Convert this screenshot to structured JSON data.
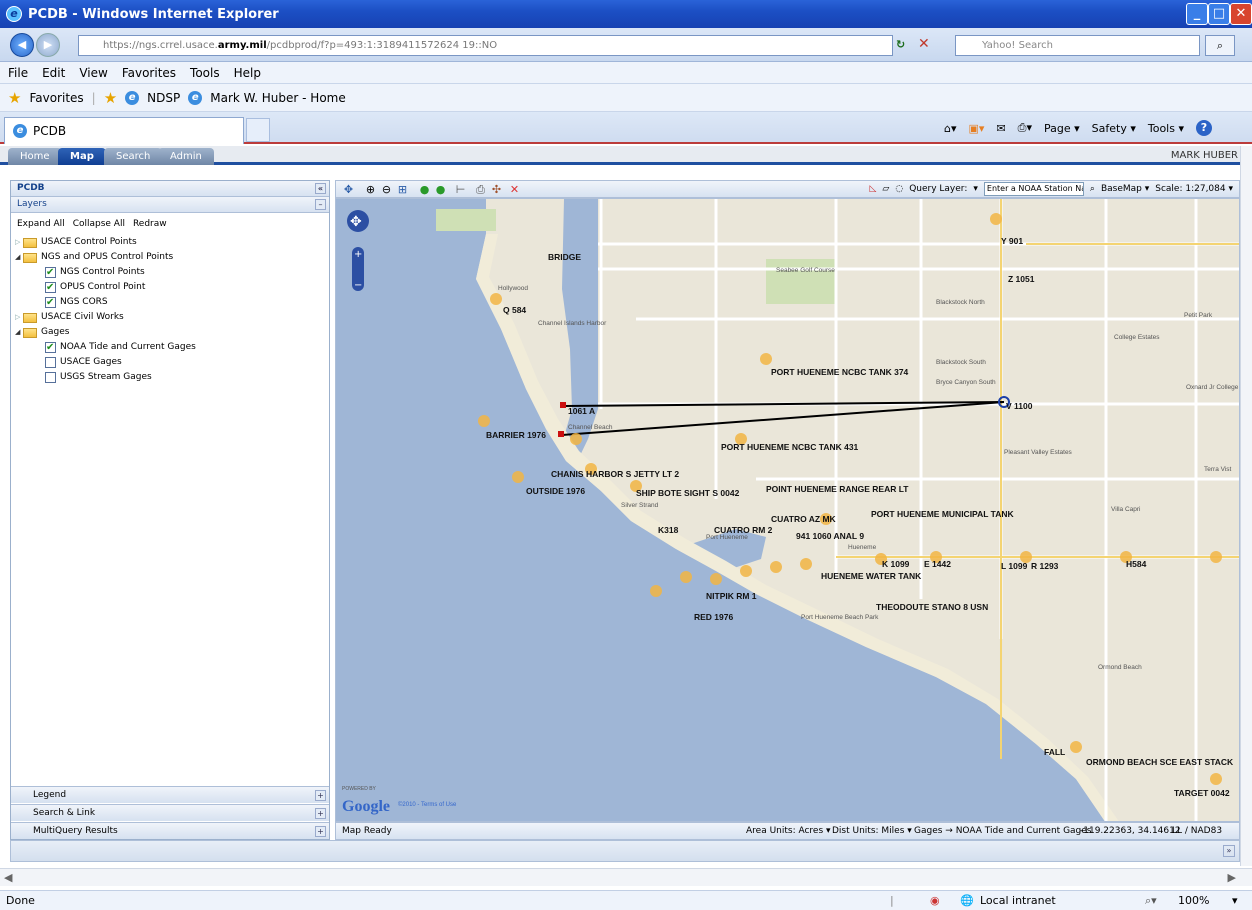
{
  "window": {
    "title": "PCDB - Windows Internet Explorer"
  },
  "address": {
    "url_prefix": "https://ngs.crrel.usace.",
    "url_domain": "army.mil",
    "url_suffix": "/pcdbprod/f?p=493:1:3189411572624 19::NO",
    "search_placeholder": "Yahoo! Search"
  },
  "menu": [
    "File",
    "Edit",
    "View",
    "Favorites",
    "Tools",
    "Help"
  ],
  "favorites": {
    "label": "Favorites",
    "items": [
      "NDSP",
      "Mark W. Huber - Home"
    ]
  },
  "ie_tab": {
    "title": "PCDB"
  },
  "command_bar": {
    "page": "Page ▾",
    "safety": "Safety ▾",
    "tools": "Tools ▾",
    "help": "?"
  },
  "app_tabs": [
    "Home",
    "Map",
    "Search",
    "Admin"
  ],
  "user": "MARK HUBER",
  "left_panel": {
    "title": "PCDB",
    "layers_title": "Layers",
    "ops": [
      "Expand All",
      "Collapse All",
      "Redraw"
    ],
    "tree": [
      {
        "label": "USACE Control Points",
        "level": 0,
        "type": "folder",
        "expanded": false
      },
      {
        "label": "NGS and OPUS Control Points",
        "level": 0,
        "type": "folder",
        "expanded": true
      },
      {
        "label": "NGS Control Points",
        "level": 1,
        "type": "check",
        "checked": true
      },
      {
        "label": "OPUS Control Point",
        "level": 1,
        "type": "check",
        "checked": true
      },
      {
        "label": "NGS CORS",
        "level": 1,
        "type": "check",
        "checked": true
      },
      {
        "label": "USACE Civil Works",
        "level": 0,
        "type": "folder",
        "expanded": false
      },
      {
        "label": "Gages",
        "level": 0,
        "type": "folder",
        "expanded": true
      },
      {
        "label": "NOAA Tide and Current Gages",
        "level": 1,
        "type": "check",
        "checked": true
      },
      {
        "label": "USACE Gages",
        "level": 1,
        "type": "check",
        "checked": false
      },
      {
        "label": "USGS Stream Gages",
        "level": 1,
        "type": "check",
        "checked": false
      }
    ],
    "accordion": [
      "Legend",
      "Search & Link",
      "MultiQuery Results"
    ]
  },
  "map_toolbar": {
    "query_layer_label": "Query Layer:",
    "query_input": "Enter a NOAA Station Name or ID",
    "basemap": "BaseMap ▾",
    "scale": "Scale: 1:27,084 ▾"
  },
  "map_labels": {
    "points": [
      "PORT HUENEME NCBC TANK 374",
      "PORT HUENEME NCBC TANK 431",
      "CHANIS HARBOR S JETTY LT 2",
      "SHIP BOTE SIGHT S 0042",
      "POINT HUENEME RANGE REAR LT",
      "PORT HUENEME MUNICIPAL TANK",
      "CUATRO AZ MK",
      "CUATRO RM 2",
      "HUENEME WATER TANK",
      "NITPIK RM 1",
      "RED 1976",
      "THEODOUTE STANO 8 USN",
      "BARRIER 1976",
      "OUTSIDE 1976",
      "ORMOND BEACH SCE EAST STACK",
      "TARGET 0042",
      "FALL",
      "K 1099",
      "E 1442",
      "L 1099",
      "R 1293",
      "H584",
      "Q 584",
      "K318",
      "941 1060 ANAL 9",
      "V 1100",
      "1061 A",
      "Y 901",
      "Z 1051",
      "BRIDGE"
    ],
    "places": [
      "Channel Islands Harbor",
      "Port Hueneme",
      "Hueneme",
      "Silver Strand",
      "Hollywood",
      "Seabee Golf Course",
      "Oxnard Jr College",
      "Ormond Beach",
      "Villa Capri",
      "College Estates",
      "Blackstock North",
      "Blackstock South",
      "Bryce Canyon South",
      "Pleasant Valley Estates",
      "Terra Vist",
      "Petit Park",
      "Port Hueneme Beach Park",
      "Channel Beach"
    ],
    "powered_by": "POWERED BY",
    "google": "Google",
    "terms": "©2010 - Terms of Use"
  },
  "statusbar": {
    "left": "Map Ready",
    "area_units": "Area Units: Acres ▾",
    "dist_units": "Dist Units: Miles ▾",
    "gages": "Gages → NOAA Tide and Current Gages",
    "coords": "-119.22363, 34.14612",
    "datum": "LL / NAD83"
  },
  "ie_status": {
    "left": "Done",
    "zone": "Local intranet",
    "zoom": "100%"
  }
}
